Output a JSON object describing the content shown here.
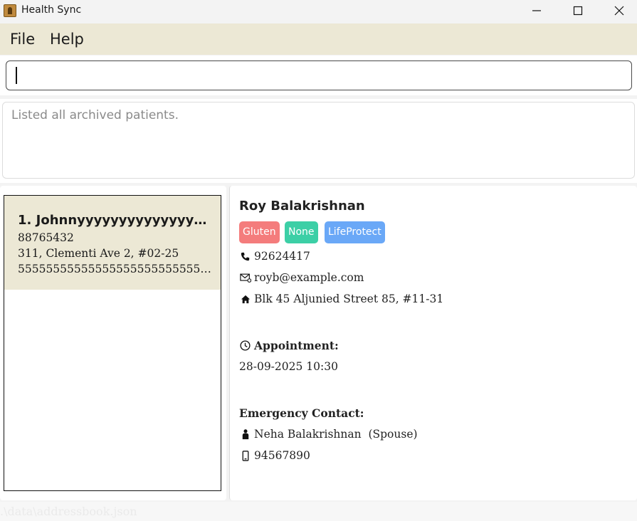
{
  "window": {
    "title": "Health Sync"
  },
  "menu": {
    "file": "File",
    "help": "Help"
  },
  "command": {
    "value": "",
    "placeholder": ""
  },
  "result": {
    "message": "Listed all archived patients."
  },
  "list": {
    "items": [
      {
        "name": "1. Johnnyyyyyyyyyyyyyyyyyyyyyyyy...",
        "phone": "88765432",
        "address": "311, Clementi Ave 2, #02-25",
        "extra": "55555555555555555555555555555..."
      }
    ]
  },
  "detail": {
    "name": "Roy Balakrishnan",
    "tags": [
      {
        "label": "Gluten",
        "color": "#f47c7c"
      },
      {
        "label": "None",
        "color": "#3ccfa6"
      },
      {
        "label": "LifeProtect",
        "color": "#6aa8f7"
      }
    ],
    "phone": "92624417",
    "email": "royb@example.com",
    "address": "Blk 45 Aljunied Street 85, #11-31",
    "appointment_label": "Appointment:",
    "appointment": "28-09-2025 10:30",
    "emergency_label": "Emergency Contact:",
    "emergency_name": "Neha Balakrishnan  (Spouse)",
    "emergency_phone": "94567890"
  },
  "status": {
    "path": ".\\data\\addressbook.json"
  },
  "colors": {
    "menu_bg": "#ece8d5",
    "selected_card": "#ece8d5"
  },
  "icons": [
    "app-icon",
    "minimize-icon",
    "maximize-icon",
    "close-icon",
    "phone-icon",
    "email-icon",
    "home-icon",
    "clock-icon",
    "person-icon",
    "mobile-icon"
  ]
}
